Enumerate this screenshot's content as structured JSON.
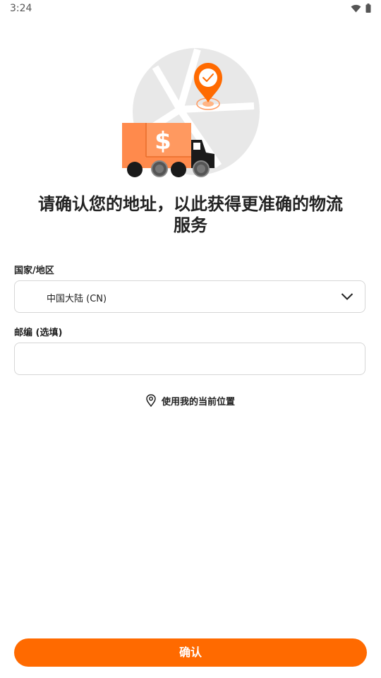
{
  "status_bar": {
    "time": "3:24",
    "icons": [
      "wifi-icon",
      "battery-icon"
    ]
  },
  "illustration": {
    "name": "delivery-truck-map-pin",
    "accent_color": "#ff6a00",
    "truck_color": "#ff8a4c",
    "map_color": "#e8e8e8",
    "currency_symbol": "$"
  },
  "headline": {
    "line1": "请确认您的地址，以此获得更准确的物流",
    "line2": "服务"
  },
  "form": {
    "country": {
      "label": "国家/地区",
      "value": "中国大陆 (CN)"
    },
    "zip": {
      "label": "邮编 (选填)",
      "value": "",
      "placeholder": ""
    }
  },
  "location_link": {
    "label": "使用我的当前位置",
    "icon": "location-pin-icon"
  },
  "confirm_button": {
    "label": "确认",
    "color": "#ff6a00"
  }
}
